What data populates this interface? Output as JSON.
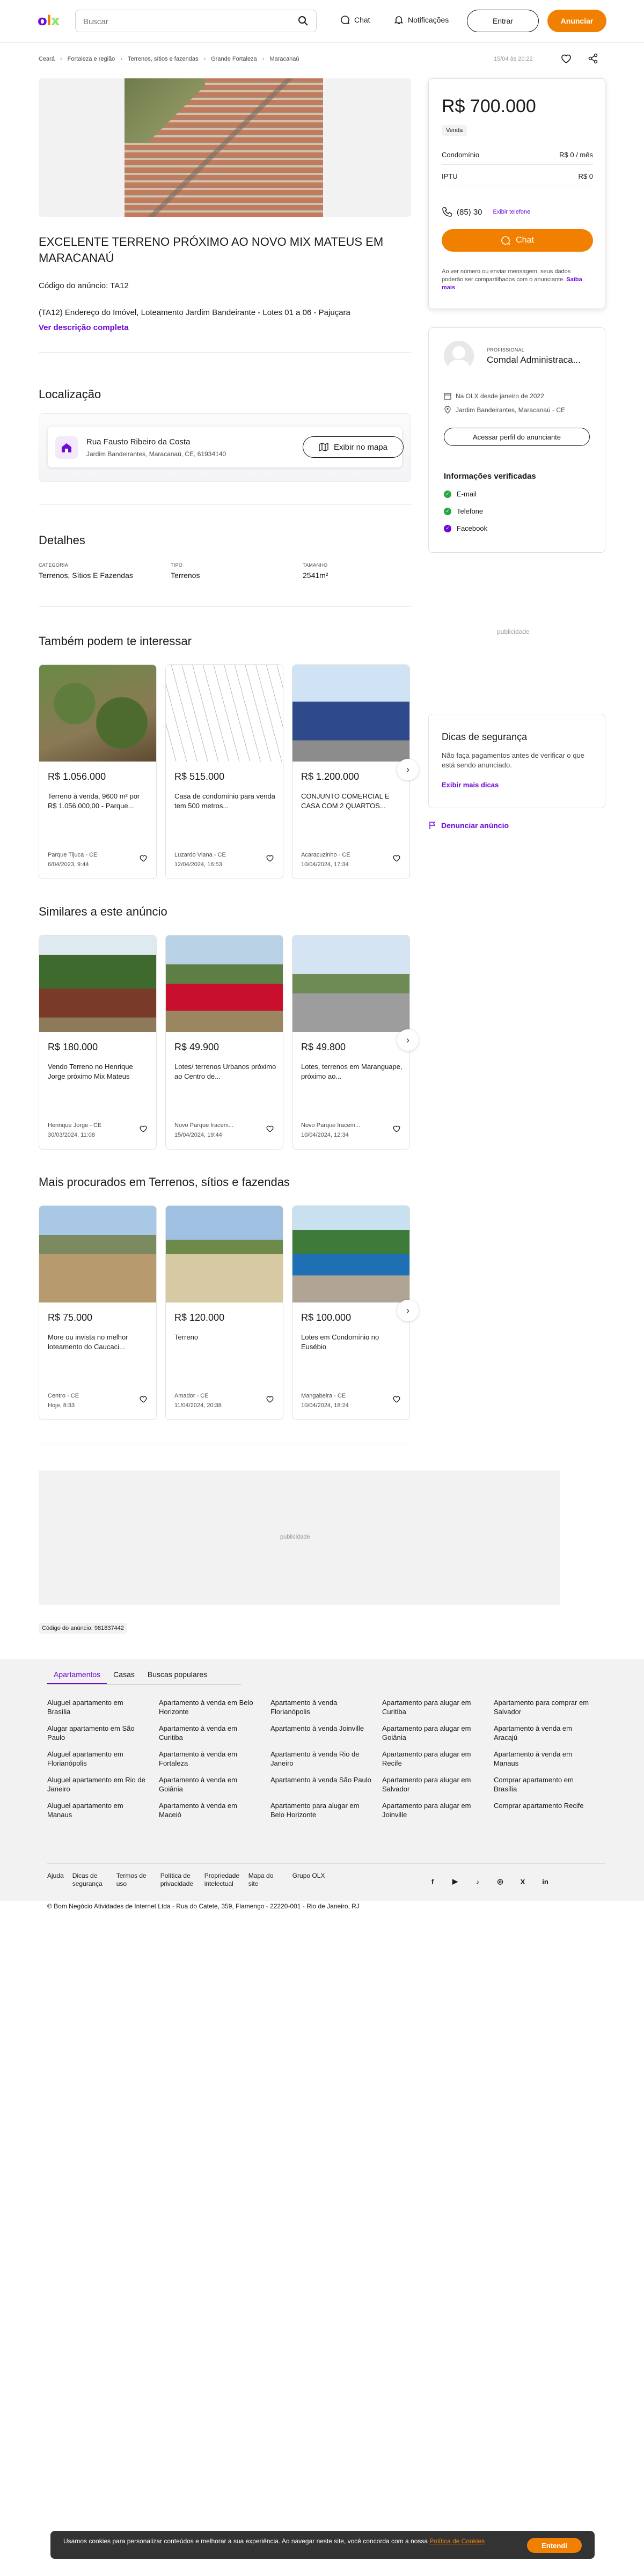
{
  "header": {
    "search_placeholder": "Buscar",
    "chat": "Chat",
    "notifications": "Notificações",
    "login": "Entrar",
    "announce": "Anunciar"
  },
  "breadcrumb": [
    "Ceará",
    "Fortaleza e região",
    "Terrenos, sítios e fazendas",
    "Grande Fortaleza",
    "Maracanaú"
  ],
  "posted_date": "15/04 às 20:22",
  "listing": {
    "title": "EXCELENTE TERRENO PRÓXIMO AO NOVO MIX MATEUS EM MARACANAÚ",
    "code": "Código do anúncio: TA12",
    "description": "(TA12) Endereço do Imóvel, Loteamento Jardim Bandeirante - Lotes 01 a 06 - Pajuçara",
    "more": "Ver descrição completa"
  },
  "location": {
    "heading": "Localização",
    "street": "Rua Fausto Ribeiro da Costa",
    "address": "Jardim Bandeirantes, Maracanaú, CE, 61934140",
    "map_button": "Exibir no mapa"
  },
  "details": {
    "heading": "Detalhes",
    "items": [
      {
        "label": "CATEGORIA",
        "value": "Terrenos, Sítios E Fazendas"
      },
      {
        "label": "TIPO",
        "value": "Terrenos"
      },
      {
        "label": "TAMANHO",
        "value": "2541m²"
      }
    ]
  },
  "sections": [
    {
      "heading": "Também podem te interessar",
      "cards": [
        {
          "price": "R$ 1.056.000",
          "title": "Terreno à venda, 9600 m² por R$ 1.056.000,00 - Parque...",
          "loc": "Parque Tijuca - CE",
          "date": "6/04/2023, 9:44"
        },
        {
          "price": "R$ 515.000",
          "title": "Casa de condomínio para venda tem 500 metros...",
          "loc": "Luzardo Viana - CE",
          "date": "12/04/2024, 16:53"
        },
        {
          "price": "R$ 1.200.000",
          "title": "CONJUNTO COMERCIAL E CASA COM 2 QUARTOS...",
          "loc": "Acaracuzinho - CE",
          "date": "10/04/2024, 17:34"
        }
      ]
    },
    {
      "heading": "Similares a este anúncio",
      "cards": [
        {
          "price": "R$ 180.000",
          "title": "Vendo Terreno no Henrique Jorge próximo Mix Mateus",
          "loc": "Henrique Jorge - CE",
          "date": "30/03/2024, 11:08"
        },
        {
          "price": "R$ 49.900",
          "title": "Lotes/ terrenos Urbanos próximo ao Centro de...",
          "loc": "Novo Parque Iracem...",
          "date": "15/04/2024, 19:44"
        },
        {
          "price": "R$ 49.800",
          "title": "Lotes, terrenos em Maranguape, próximo ao...",
          "loc": "Novo Parque Iracem...",
          "date": "10/04/2024, 12:34"
        }
      ]
    },
    {
      "heading": "Mais procurados em Terrenos, sítios e fazendas",
      "cards": [
        {
          "price": "R$ 75.000",
          "title": "More ou invista no melhor loteamento do Caucaci...",
          "loc": "Centro - CE",
          "date": "Hoje, 8:33"
        },
        {
          "price": "R$ 120.000",
          "title": "Terreno",
          "loc": "Amador - CE",
          "date": "11/04/2024, 20:38"
        },
        {
          "price": "R$ 100.000",
          "title": "Lotes em Condomínio no Eusébio",
          "loc": "Mangabeira - CE",
          "date": "10/04/2024, 18:24"
        }
      ]
    }
  ],
  "price_card": {
    "price": "R$ 700.000",
    "tag": "Venda",
    "fees": [
      {
        "label": "Condomínio",
        "value": "R$ 0 / mês"
      },
      {
        "label": "IPTU",
        "value": "R$ 0"
      }
    ],
    "phone": "(85) 30",
    "phone_hidden": "",
    "show_phone": "Exibir telefone",
    "chat": "Chat",
    "note": "Ao ver número ou enviar mensagem, seus dados poderão ser compartilhados com o anunciante.",
    "note_link": "Saiba mais"
  },
  "seller": {
    "label": "PROFISSIONAL",
    "name": "Comdal Administraca...",
    "since": "Na OLX desde janeiro de 2022",
    "place": "Jardim Bandeirantes, Maracanaú - CE",
    "profile_button": "Acessar perfil do anunciante",
    "verified_heading": "Informações verificadas",
    "verified": [
      "E-mail",
      "Telefone",
      "Facebook"
    ]
  },
  "ad_label": "publicidade",
  "safety": {
    "title": "Dicas de segurança",
    "text": "Não faça pagamentos antes de verificar o que está sendo anunciado.",
    "link": "Exibir mais dicas"
  },
  "report": "Denunciar anúncio",
  "ad_code": "Código do anúncio: 981837442",
  "footer": {
    "tabs": [
      "Apartamentos",
      "Casas",
      "Buscas populares"
    ],
    "links": [
      "Aluguel apartamento em Brasília",
      "Apartamento à venda em Belo Horizonte",
      "Apartamento à venda Florianópolis",
      "Apartamento para alugar em Curitiba",
      "Apartamento para comprar em Salvador",
      "Alugar apartamento em São Paulo",
      "Apartamento à venda em Curitiba",
      "Apartamento à venda Joinville",
      "Apartamento para alugar em Goiânia",
      "Apartamento à venda em Aracajú",
      "Aluguel apartamento em Florianópolis",
      "Apartamento à venda em Fortaleza",
      "Apartamento à venda Rio de Janeiro",
      "Apartamento para alugar em Recife",
      "Apartamento à venda em Manaus",
      "Aluguel apartamento em Rio de Janeiro",
      "Apartamento à venda em Goiânia",
      "Apartamento à venda São Paulo",
      "Apartamento para alugar em Salvador",
      "Comprar apartamento em Brasília",
      "Aluguel apartamento em Manaus",
      "Apartamento à venda em Maceió",
      "Apartamento para alugar em Belo Horizonte",
      "Apartamento para alugar em Joinville",
      "Comprar apartamento Recife"
    ],
    "bottom_links": [
      "Ajuda",
      "Dicas de segurança",
      "Termos de uso",
      "Política de privacidade",
      "Propriedade intelectual",
      "Mapa do site",
      "Grupo OLX"
    ],
    "copyright": "© Bom Negócio Atividades de Internet Ltda - Rua do Catete, 359, Flamengo - 22220-001 - Rio de Janeiro, RJ"
  },
  "cookie": {
    "text": "Usamos cookies para personalizar conteúdos e melhorar a sua experiência. Ao navegar neste site, você concorda com a nossa",
    "link": "Política de Cookies",
    "button": "Entendi"
  }
}
